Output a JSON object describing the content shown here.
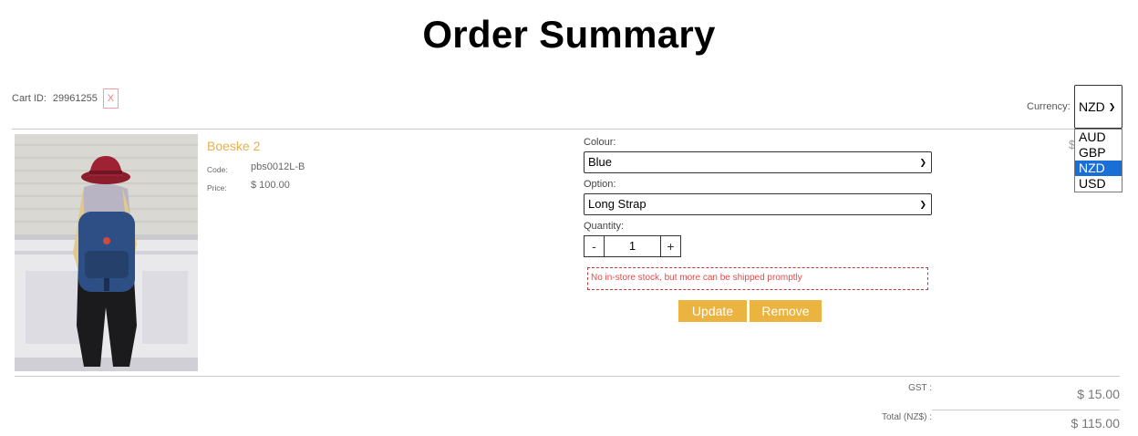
{
  "header": {
    "title": "Order Summary"
  },
  "cart": {
    "id_label": "Cart ID:",
    "id_value": "29961255",
    "clear_label": "X"
  },
  "currency": {
    "label": "Currency:",
    "selected": "NZD",
    "options": [
      "AUD",
      "GBP",
      "NZD",
      "USD"
    ]
  },
  "item": {
    "name": "Boeske 2",
    "code_label": "Code:",
    "code_value": "pbs0012L-B",
    "price_label": "Price:",
    "price_value": "$ 100.00",
    "line_price_hint": "$",
    "colour_label": "Colour:",
    "colour_value": "Blue",
    "option_label": "Option:",
    "option_value": "Long Strap",
    "quantity_label": "Quantity:",
    "quantity_value": "1",
    "decrement": "-",
    "increment": "+",
    "stock_note": "No in-store stock, but more can be shipped promptly",
    "update_label": "Update",
    "remove_label": "Remove"
  },
  "summary": {
    "gst_label": "GST :",
    "gst_value": "$ 15.00",
    "total_label": "Total (NZ$) :",
    "total_value": "$ 115.00"
  },
  "colors": {
    "accent": "#ebb33f",
    "link": "#e8b04c",
    "alert": "#e24b4b",
    "selected_option": "#1a6fd6"
  }
}
